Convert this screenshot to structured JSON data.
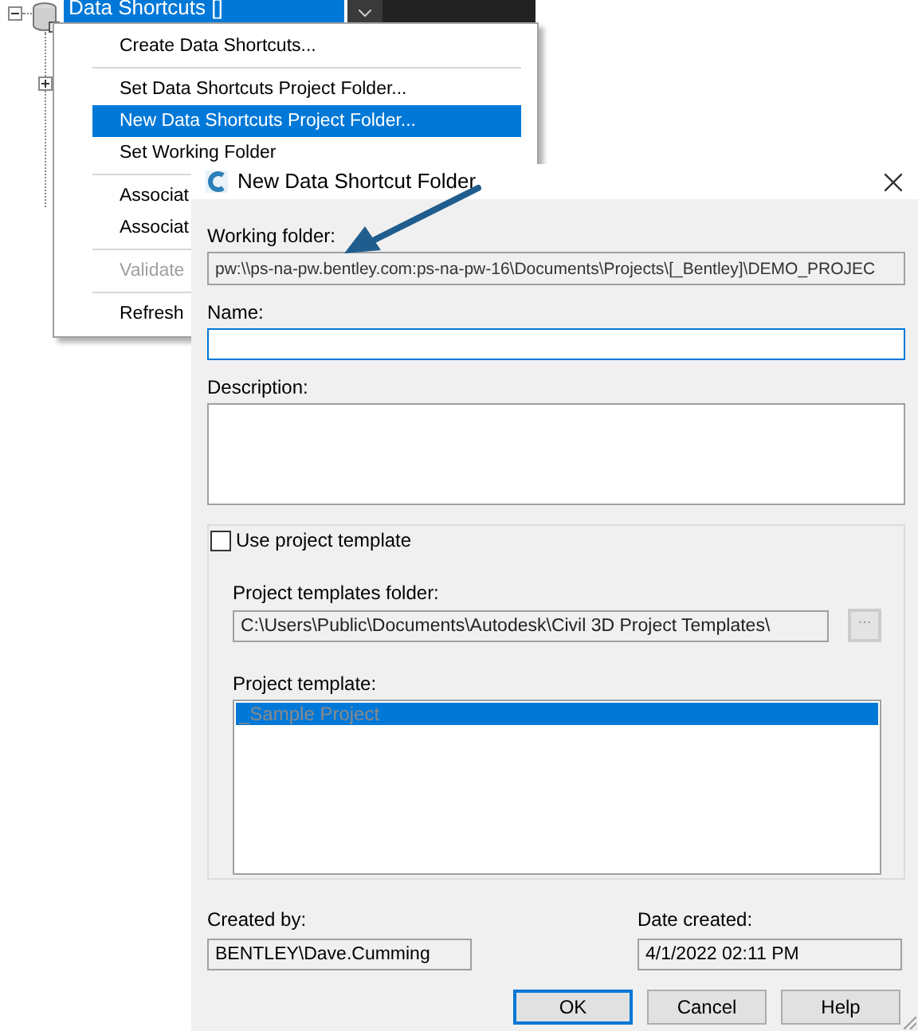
{
  "tree": {
    "node": {
      "label": "Data Shortcuts []",
      "selected": true,
      "expanded": true
    }
  },
  "context_menu": {
    "items": [
      {
        "kind": "item",
        "label": "Create Data Shortcuts...",
        "selected": false,
        "disabled": false
      },
      {
        "kind": "separator"
      },
      {
        "kind": "item",
        "label": "Set Data Shortcuts Project Folder...",
        "selected": false,
        "disabled": false
      },
      {
        "kind": "item",
        "label": "New Data Shortcuts Project Folder...",
        "selected": true,
        "disabled": false
      },
      {
        "kind": "item",
        "label": "Set Working Folder",
        "selected": false,
        "disabled": false
      },
      {
        "kind": "separator"
      },
      {
        "kind": "item",
        "label": "Associat",
        "selected": false,
        "disabled": false
      },
      {
        "kind": "item",
        "label": "Associat",
        "selected": false,
        "disabled": false
      },
      {
        "kind": "separator"
      },
      {
        "kind": "item",
        "label": "Validate",
        "selected": false,
        "disabled": true
      },
      {
        "kind": "separator"
      },
      {
        "kind": "item",
        "label": "Refresh",
        "selected": false,
        "disabled": false
      }
    ]
  },
  "dialog": {
    "title": "New Data Shortcut Folder",
    "working_folder": {
      "label": "Working folder:",
      "value": "pw:\\\\ps-na-pw.bentley.com:ps-na-pw-16\\Documents\\Projects\\[_Bentley]\\DEMO_PROJEC",
      "disabled": true
    },
    "name": {
      "label": "Name:",
      "focused": true
    },
    "description": {
      "label": "Description:"
    },
    "use_project_template": {
      "label": "Use project template",
      "checked": false
    },
    "project_templates_folder": {
      "label": "Project templates folder:",
      "value": "C:\\Users\\Public\\Documents\\Autodesk\\Civil 3D Project Templates\\",
      "browse": "..."
    },
    "project_template": {
      "label": "Project template:",
      "items": [
        {
          "label": "_Sample Project",
          "selected": true
        }
      ]
    },
    "created_by": {
      "label": "Created by:",
      "value": "BENTLEY\\Dave.Cumming"
    },
    "date_created": {
      "label": "Date created:",
      "value": "4/1/2022 02:11 PM"
    },
    "buttons": [
      {
        "label": "OK",
        "default": true
      },
      {
        "label": "Cancel",
        "default": false
      },
      {
        "label": "Help",
        "default": false
      }
    ]
  }
}
